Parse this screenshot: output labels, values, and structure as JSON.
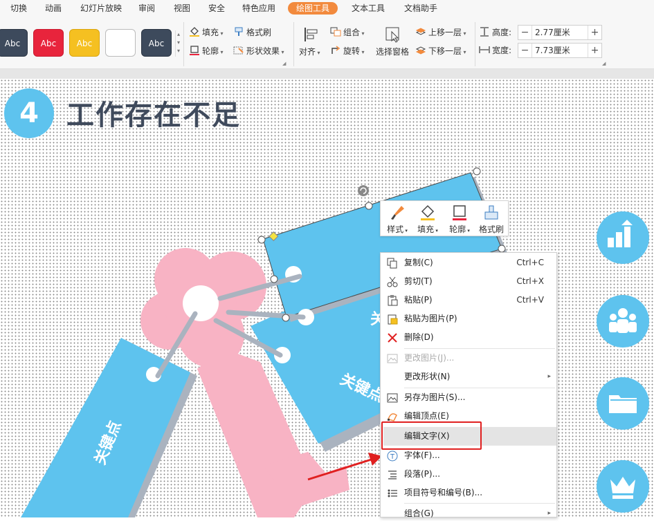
{
  "tabs": [
    {
      "label": "切换",
      "active": false
    },
    {
      "label": "动画",
      "active": false
    },
    {
      "label": "幻灯片放映",
      "active": false
    },
    {
      "label": "审阅",
      "active": false
    },
    {
      "label": "视图",
      "active": false
    },
    {
      "label": "安全",
      "active": false
    },
    {
      "label": "特色应用",
      "active": false
    },
    {
      "label": "绘图工具",
      "active": true
    },
    {
      "label": "文本工具",
      "active": false
    },
    {
      "label": "文档助手",
      "active": false
    }
  ],
  "ribbon": {
    "styles": [
      {
        "label": "Abc",
        "color": "#3d4a5c"
      },
      {
        "label": "Abc",
        "color": "#e8243c"
      },
      {
        "label": "Abc",
        "color": "#f5c021"
      },
      {
        "label": "",
        "color": "#ffffff"
      },
      {
        "label": "Abc",
        "color": "#3d4a5c"
      }
    ],
    "fill": "填充",
    "format_painter": "格式刷",
    "outline": "轮廓",
    "shape_effects": "形状效果",
    "align": "对齐",
    "group": "组合",
    "rotate": "旋转",
    "selection_pane": "选择窗格",
    "bring_forward": "上移一层",
    "send_backward": "下移一层",
    "height_label": "高度:",
    "height_value": "2.77厘米",
    "width_label": "宽度:",
    "width_value": "7.73厘米"
  },
  "slide": {
    "number": "4",
    "title": "工作存在不足",
    "tag_text": "关键点",
    "tag_text_partial": "关键点",
    "tag_text_partial2": "关"
  },
  "mini_toolbar": {
    "style": "样式",
    "fill": "填充",
    "outline": "轮廓",
    "format_painter": "格式刷"
  },
  "context_menu": [
    {
      "label": "复制(C)",
      "shortcut": "Ctrl+C",
      "icon": "copy-icon"
    },
    {
      "label": "剪切(T)",
      "shortcut": "Ctrl+X",
      "icon": "cut-icon"
    },
    {
      "label": "粘贴(P)",
      "shortcut": "Ctrl+V",
      "icon": "paste-icon"
    },
    {
      "label": "粘贴为图片(P)",
      "shortcut": "",
      "icon": "paste-as-image-icon"
    },
    {
      "label": "删除(D)",
      "shortcut": "",
      "icon": "delete-icon"
    },
    {
      "label": "更改图片(J)...",
      "shortcut": "",
      "icon": "change-image-icon",
      "disabled": true
    },
    {
      "label": "更改形状(N)",
      "shortcut": "",
      "icon": "",
      "submenu": true
    },
    {
      "label": "另存为图片(S)...",
      "shortcut": "",
      "icon": "save-as-image-icon"
    },
    {
      "label": "编辑顶点(E)",
      "shortcut": "",
      "icon": "edit-points-icon"
    },
    {
      "label": "编辑文字(X)",
      "shortcut": "",
      "icon": "",
      "highlighted": true
    },
    {
      "label": "字体(F)...",
      "shortcut": "",
      "icon": "font-icon"
    },
    {
      "label": "段落(P)...",
      "shortcut": "",
      "icon": "paragraph-icon"
    },
    {
      "label": "项目符号和编号(B)...",
      "shortcut": "",
      "icon": "bullets-icon"
    },
    {
      "label": "组合(G)",
      "shortcut": "",
      "icon": "",
      "submenu": true
    }
  ]
}
